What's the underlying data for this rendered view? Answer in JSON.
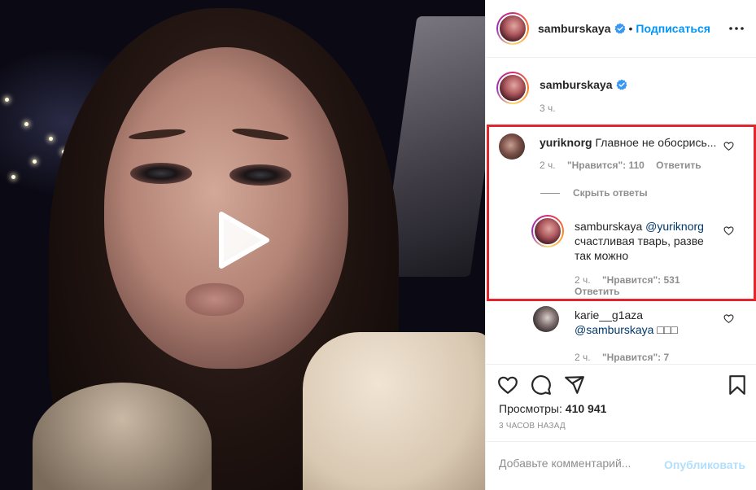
{
  "header": {
    "username": "samburskaya",
    "separator": "•",
    "follow_label": "Подписаться"
  },
  "post": {
    "owner_username": "samburskaya",
    "owner_time": "3 ч."
  },
  "comments": [
    {
      "username": "yuriknorg",
      "text": "Главное не обосрись...",
      "time": "2 ч.",
      "likes": "\"Нравится\": 110",
      "reply_label": "Ответить",
      "hide_replies_label": "Скрыть ответы",
      "replies": [
        {
          "username": "samburskaya",
          "mention": "@yuriknorg",
          "text": "счастливая тварь, разве так можно",
          "time": "2 ч.",
          "likes": "\"Нравится\": 531",
          "reply_label": "Ответить"
        },
        {
          "username": "karie__g1aza",
          "mention": "@samburskaya",
          "text": "□□□",
          "time": "2 ч.",
          "likes": "\"Нравится\": 7"
        }
      ]
    }
  ],
  "stats": {
    "views_label": "Просмотры:",
    "views_value": "410 941",
    "ago": "3 ЧАСОВ НАЗАД"
  },
  "add_comment": {
    "placeholder": "Добавьте комментарий...",
    "publish_label": "Опубликовать"
  },
  "icons": [
    "play-icon",
    "verified-icon",
    "more-icon",
    "heart-icon",
    "comment-icon",
    "share-icon",
    "bookmark-icon"
  ],
  "colors": {
    "accent": "#0095f6",
    "highlight_border": "#e3262d",
    "muted": "#8e8e8e"
  }
}
